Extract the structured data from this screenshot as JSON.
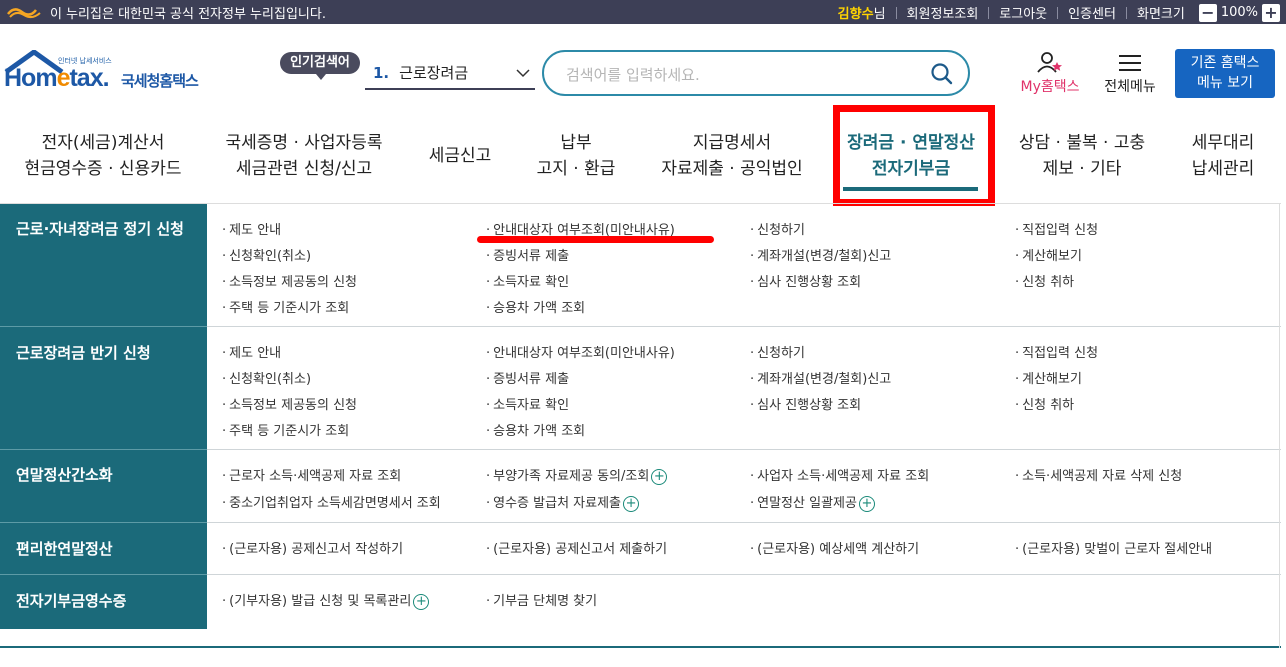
{
  "topbar": {
    "gov_notice": "이 누리집은 대한민국 공식 전자정부 누리집입니다.",
    "user_name": "김향수",
    "user_suffix": "님",
    "links": [
      "회원정보조회",
      "로그아웃",
      "인증센터",
      "화면크기"
    ],
    "zoom_minus": "−",
    "zoom_value": "100%",
    "zoom_plus": "+"
  },
  "header": {
    "logo_small": "인터넷 납세서비스",
    "logo_main_pre": "Hom",
    "logo_main_e": "e",
    "logo_main_post": "tax.",
    "logo_kr": "국세청홈택스",
    "popular_label": "인기검색어",
    "popular_rank": "1.",
    "popular_term": "근로장려금",
    "search_placeholder": "검색어를 입력하세요.",
    "my_hometax": "My홈택스",
    "all_menu": "전체메뉴",
    "old_site_line1": "기존 홈택스",
    "old_site_line2": "메뉴 보기"
  },
  "gnb": [
    {
      "line1": "전자(세금)계산서",
      "line2": "현금영수증 · 신용카드"
    },
    {
      "line1": "국세증명 · 사업자등록",
      "line2": "세금관련 신청/신고"
    },
    {
      "line1": "세금신고",
      "line2": ""
    },
    {
      "line1": "납부",
      "line2": "고지 · 환급"
    },
    {
      "line1": "지급명세서",
      "line2": "자료제출 · 공익법인"
    },
    {
      "line1": "장려금 · 연말정산",
      "line2": "전자기부금"
    },
    {
      "line1": "상담 · 불복 · 고충",
      "line2": "제보 · 기타"
    },
    {
      "line1": "세무대리",
      "line2": "납세관리"
    }
  ],
  "sections": [
    {
      "title": "근로·자녀장려금 정기 신청",
      "cols": [
        [
          "제도 안내",
          "신청확인(취소)",
          "소득정보 제공동의 신청",
          "주택 등 기준시가 조회"
        ],
        [
          "안내대상자 여부조회(미안내사유)",
          "증빙서류 제출",
          "소득자료 확인",
          "승용차 가액 조회"
        ],
        [
          "신청하기",
          "계좌개설(변경/철회)신고",
          "심사 진행상황 조회"
        ],
        [
          "직접입력 신청",
          "계산해보기",
          "신청 취하"
        ]
      ]
    },
    {
      "title": "근로장려금 반기 신청",
      "cols": [
        [
          "제도 안내",
          "신청확인(취소)",
          "소득정보 제공동의 신청",
          "주택 등 기준시가 조회"
        ],
        [
          "안내대상자 여부조회(미안내사유)",
          "증빙서류 제출",
          "소득자료 확인",
          "승용차 가액 조회"
        ],
        [
          "신청하기",
          "계좌개설(변경/철회)신고",
          "심사 진행상황 조회"
        ],
        [
          "직접입력 신청",
          "계산해보기",
          "신청 취하"
        ]
      ]
    },
    {
      "title": "연말정산간소화",
      "cols": [
        [
          "근로자 소득·세액공제 자료 조회",
          "중소기업취업자 소득세감면명세서 조회"
        ],
        [
          "부양가족 자료제공 동의/조회",
          "영수증 발급처 자료제출"
        ],
        [
          "사업자 소득·세액공제 자료 조회",
          "연말정산 일괄제공"
        ],
        [
          "소득·세액공제 자료 삭제 신청"
        ]
      ]
    },
    {
      "title": "편리한연말정산",
      "cols": [
        [
          "(근로자용) 공제신고서 작성하기"
        ],
        [
          "(근로자용) 공제신고서 제출하기"
        ],
        [
          "(근로자용) 예상세액 계산하기"
        ],
        [
          "(근로자용) 맞벌이 근로자 절세안내"
        ]
      ]
    },
    {
      "title": "전자기부금영수증",
      "cols": [
        [
          "(기부자용) 발급 신청 및 목록관리"
        ],
        [
          "기부금 단체명 찾기"
        ],
        [],
        []
      ]
    }
  ],
  "bullet": "·",
  "plus_symbol": "+",
  "colors": {
    "topbar_bg": "#3d3f56",
    "teal": "#1b6a7a",
    "brand_blue": "#1d58a6",
    "highlight_red": "#ff0000"
  }
}
